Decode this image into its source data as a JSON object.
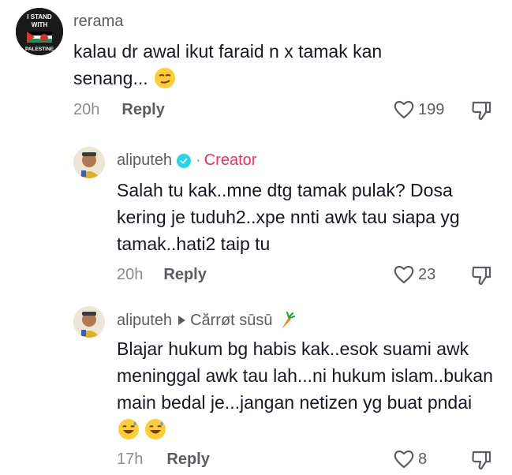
{
  "comments": [
    {
      "username": "rerama",
      "avatar_text": [
        "I STAND",
        "WITH",
        "PALESTINE"
      ],
      "text": "kalau dr awal ikut faraid n x tamak kan senang...",
      "emoji": "smirk",
      "time": "20h",
      "reply_label": "Reply",
      "likes": "199"
    },
    {
      "username": "aliputeh",
      "verified": true,
      "separator": "·",
      "badge": "Creator",
      "text": "Salah tu kak..mne dtg tamak pulak? Dosa kering je tuduh2..xpe nnti awk tau siapa yg tamak..hati2 taip tu",
      "time": "20h",
      "reply_label": "Reply",
      "likes": "23"
    },
    {
      "username": "aliputeh",
      "reply_to": "Cărrøt sūsū",
      "reply_to_emoji": "carrot",
      "text": "Blajar hukum bg habis kak..esok suami awk meninggal awk tau lah...ni hukum islam..bukan main bedal je...jangan netizen yg buat pndai",
      "emoji": "sweat-smile",
      "time": "17h",
      "reply_label": "Reply",
      "likes": "8"
    }
  ]
}
